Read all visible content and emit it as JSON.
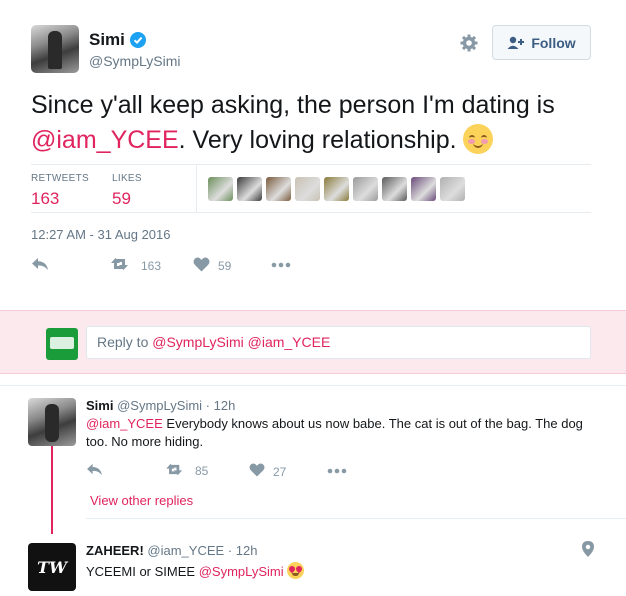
{
  "tweet": {
    "author_name": "Simi",
    "author_handle": "@SympLySimi",
    "follow_label": "Follow",
    "text_part1": "Since y'all keep asking, the person I'm dating is ",
    "text_mention": "@iam_YCEE",
    "text_part2": ". Very loving relationship.",
    "emoji": "smiling-face-with-blush",
    "retweets_label": "RETWEETS",
    "retweets_count": "163",
    "likes_label": "LIKES",
    "likes_count": "59",
    "timestamp": "12:27 AM - 31 Aug 2016",
    "action_retweet_count": "163",
    "action_like_count": "59",
    "liker_colors": [
      "#6b8f5a",
      "#3a3a3a",
      "#7a5a3c",
      "#c9c2b4",
      "#8a7a3a",
      "#9a9a9a",
      "#5a5a5a",
      "#6a4a7a",
      "#b0b0b0"
    ]
  },
  "reply_box": {
    "prefix": "Reply to ",
    "mentions": "@SympLySimi @iam_YCEE"
  },
  "replies": [
    {
      "name": "Simi",
      "handle": "@SympLySimi",
      "time": "· 12h",
      "mention": "@iam_YCEE",
      "text": " Everybody knows about us now babe. The cat is out of the bag. The dog too. No more hiding.",
      "retweets": "85",
      "likes": "27"
    },
    {
      "name": "ZAHEER!",
      "handle": "@iam_YCEE",
      "time": "· 12h",
      "text": "YCEEMI or SIMEE ",
      "mention": "@SympLySimi",
      "emoji": "heart-eyes",
      "avatar_text": "TW"
    }
  ],
  "view_other_replies": "View other replies",
  "colors": {
    "accent": "#e0245e",
    "muted": "#657786",
    "icon": "#8899a6",
    "verified": "#1da1f2",
    "reply_bg": "#fbe9ee"
  }
}
